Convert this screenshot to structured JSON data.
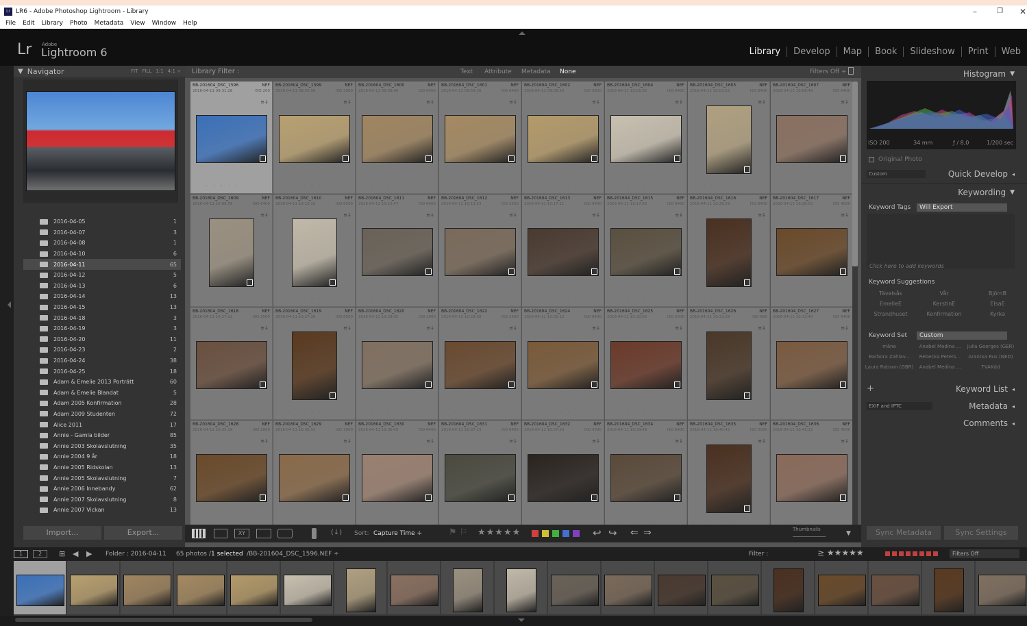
{
  "window": {
    "title": "LR6 - Adobe Photoshop Lightroom - Library",
    "app_icon": "Lr"
  },
  "menu": [
    "File",
    "Edit",
    "Library",
    "Photo",
    "Metadata",
    "View",
    "Window",
    "Help"
  ],
  "identity": {
    "lr": "Lr",
    "adobe": "Adobe",
    "product": "Lightroom 6"
  },
  "modules": [
    "Library",
    "Develop",
    "Map",
    "Book",
    "Slideshow",
    "Print",
    "Web"
  ],
  "navigator": {
    "title": "Navigator",
    "zoom": [
      "FIT",
      "FILL",
      "1:1",
      "4:1 ÷"
    ]
  },
  "folders": [
    {
      "name": "2016-04-05",
      "count": "1"
    },
    {
      "name": "2016-04-07",
      "count": "3"
    },
    {
      "name": "2016-04-08",
      "count": "1"
    },
    {
      "name": "2016-04-10",
      "count": "6"
    },
    {
      "name": "2016-04-11",
      "count": "65",
      "selected": true
    },
    {
      "name": "2016-04-12",
      "count": "5"
    },
    {
      "name": "2016-04-13",
      "count": "6"
    },
    {
      "name": "2016-04-14",
      "count": "13"
    },
    {
      "name": "2016-04-15",
      "count": "13"
    },
    {
      "name": "2016-04-18",
      "count": "3"
    },
    {
      "name": "2016-04-19",
      "count": "3"
    },
    {
      "name": "2016-04-20",
      "count": "11"
    },
    {
      "name": "2016-04-23",
      "count": "2"
    },
    {
      "name": "2016-04-24",
      "count": "38"
    },
    {
      "name": "2016-04-25",
      "count": "18"
    },
    {
      "name": "Adam & Emelie 2013 Porträtt",
      "count": "60"
    },
    {
      "name": "Adam & Emelie Blandat",
      "count": "5"
    },
    {
      "name": "Adam 2005 Konfirmation",
      "count": "28"
    },
    {
      "name": "Adam 2009 Studenten",
      "count": "72"
    },
    {
      "name": "Alice 2011",
      "count": "17"
    },
    {
      "name": "Annie - Gamla bilder",
      "count": "85"
    },
    {
      "name": "Annie 2003 Skolavslutning",
      "count": "35"
    },
    {
      "name": "Annie 2004 9 år",
      "count": "18"
    },
    {
      "name": "Annie 2005 Ridskolan",
      "count": "13"
    },
    {
      "name": "Annie 2005 Skolavslutning",
      "count": "7"
    },
    {
      "name": "Annie 2006 Innebandy",
      "count": "62"
    },
    {
      "name": "Annie 2007 Skolavslutning",
      "count": "8"
    },
    {
      "name": "Annie 2007 Vickan",
      "count": "13"
    }
  ],
  "left_buttons": {
    "import": "Import...",
    "export": "Export..."
  },
  "filter": {
    "label": "Library Filter :",
    "tabs": [
      "Text",
      "Attribute",
      "Metadata",
      "None"
    ],
    "status": "Filters Off ÷"
  },
  "grid": [
    {
      "name": "BB-201604_DSC_1596",
      "date": "2016-04-11 09:31:28",
      "iso": "ISO 200",
      "type": "NEF",
      "color": "#3a6fb8",
      "orient": "l",
      "selected": true
    },
    {
      "name": "BB-201604_DSC_1599",
      "date": "2016-04-11 09:55:06",
      "iso": "ISO 2000",
      "type": "NEF",
      "color": "#b8a070",
      "orient": "l"
    },
    {
      "name": "BB-201604_DSC_1600",
      "date": "2016-04-11 09:56:06",
      "iso": "ISO 6400",
      "type": "NEF",
      "color": "#a08560",
      "orient": "l"
    },
    {
      "name": "BB-201604_DSC_1601",
      "date": "2016-04-11 09:56:16",
      "iso": "ISO 6400",
      "type": "NEF",
      "color": "#a58a62",
      "orient": "l"
    },
    {
      "name": "BB-201604_DSC_1602",
      "date": "2016-04-11 09:58:20",
      "iso": "ISO 3600",
      "type": "NEF",
      "color": "#b49a6a",
      "orient": "l"
    },
    {
      "name": "BB-201604_DSC_1604",
      "date": "2016-04-11 10:01:02",
      "iso": "ISO 6400",
      "type": "NEF",
      "color": "#c8c0b0",
      "orient": "l"
    },
    {
      "name": "BB-201604_DSC_1605",
      "date": "2016-04-11 10:01:52",
      "iso": "ISO 6400",
      "type": "NEF",
      "color": "#b0a080",
      "orient": "p"
    },
    {
      "name": "BB-201604_DSC_1607",
      "date": "2016-04-11 10:08:49",
      "iso": "ISO 6400",
      "type": "NEF",
      "color": "#8a7060",
      "orient": "l"
    },
    {
      "name": "BB-201604_DSC_1609",
      "date": "2016-04-11 10:09:58",
      "iso": "ISO 6400",
      "type": "NEF",
      "color": "#9a9080",
      "orient": "p"
    },
    {
      "name": "BB-201604_DSC_1610",
      "date": "2016-04-11 10:10:15",
      "iso": "ISO 6500",
      "type": "NEF",
      "color": "#c0b8a8",
      "orient": "p"
    },
    {
      "name": "BB-201604_DSC_1611",
      "date": "2016-04-11 10:12:47",
      "iso": "ISO 6400",
      "type": "NEF",
      "color": "#6a6258",
      "orient": "l"
    },
    {
      "name": "BB-201604_DSC_1612",
      "date": "2016-04-11 10:13:53",
      "iso": "ISO 2500",
      "type": "NEF",
      "color": "#7a6a5a",
      "orient": "l"
    },
    {
      "name": "BB-201604_DSC_1613",
      "date": "2016-04-11 10:17:11",
      "iso": "ISO 6400",
      "type": "NEF",
      "color": "#4a3a30",
      "orient": "l"
    },
    {
      "name": "BB-201604_DSC_1615",
      "date": "2016-04-11 10:17:55",
      "iso": "ISO 6400",
      "type": "NEF",
      "color": "#5a5040",
      "orient": "l"
    },
    {
      "name": "BB-201604_DSC_1616",
      "date": "2016-04-11 10:26:29",
      "iso": "ISO 6400",
      "type": "NEF",
      "color": "#4a3020",
      "orient": "p"
    },
    {
      "name": "BB-201604_DSC_1617",
      "date": "2016-04-11 10:26:50",
      "iso": "ISO 4000",
      "type": "NEF",
      "color": "#6a4a2a",
      "orient": "l"
    },
    {
      "name": "BB-201604_DSC_1618",
      "date": "2016-04-11 10:27:21",
      "iso": "ISO 2500",
      "type": "NEF",
      "color": "#6a5040",
      "orient": "l"
    },
    {
      "name": "BB-201604_DSC_1619",
      "date": "2016-04-11 10:27:36",
      "iso": "ISO 6500",
      "type": "NEF",
      "color": "#5a3a20",
      "orient": "p"
    },
    {
      "name": "BB-201604_DSC_1620",
      "date": "2016-04-11 10:28:05",
      "iso": "ISO 2000",
      "type": "NEF",
      "color": "#807060",
      "orient": "l"
    },
    {
      "name": "BB-201604_DSC_1622",
      "date": "2016-04-11 10:28:38",
      "iso": "ISO 2500",
      "type": "NEF",
      "color": "#6a4a30",
      "orient": "l"
    },
    {
      "name": "BB-201604_DSC_1624",
      "date": "2016-04-11 10:30:12",
      "iso": "ISO 6400",
      "type": "NEF",
      "color": "#7a5a3a",
      "orient": "l"
    },
    {
      "name": "BB-201604_DSC_1625",
      "date": "2016-04-11 10:32:05",
      "iso": "ISO 2000",
      "type": "NEF",
      "color": "#6a3a2a",
      "orient": "l"
    },
    {
      "name": "BB-201604_DSC_1626",
      "date": "2016-04-11 10:32:29",
      "iso": "ISO 800",
      "type": "NEF",
      "color": "#4a3828",
      "orient": "p"
    },
    {
      "name": "BB-201604_DSC_1627",
      "date": "2016-04-11 10:33:40",
      "iso": "ISO 6400",
      "type": "NEF",
      "color": "#7a5a40",
      "orient": "l"
    },
    {
      "name": "BB-201604_DSC_1628",
      "date": "2016-04-11 10:35:16",
      "iso": "ISO 2000",
      "type": "NEF",
      "color": "#6a4a2a",
      "orient": "l"
    },
    {
      "name": "BB-201604_DSC_1629",
      "date": "2016-04-11 10:36:31",
      "iso": "ISO 1000",
      "type": "NEF",
      "color": "#8a6a4a",
      "orient": "l"
    },
    {
      "name": "BB-201604_DSC_1630",
      "date": "2016-04-11 10:36:45",
      "iso": "ISO 6400",
      "type": "NEF",
      "color": "#9a8070",
      "orient": "l"
    },
    {
      "name": "BB-201604_DSC_1631",
      "date": "2016-04-11 10:37:23",
      "iso": "ISO 6400",
      "type": "NEF",
      "color": "#4a4a40",
      "orient": "l"
    },
    {
      "name": "BB-201604_DSC_1632",
      "date": "2016-04-11 10:37:29",
      "iso": "ISO 4000",
      "type": "NEF",
      "color": "#2a2420",
      "orient": "l"
    },
    {
      "name": "BB-201604_DSC_1634",
      "date": "2016-04-11 10:39:49",
      "iso": "ISO 6400",
      "type": "NEF",
      "color": "#5a4a3a",
      "orient": "l"
    },
    {
      "name": "BB-201604_DSC_1635",
      "date": "2016-04-11 10:40:42",
      "iso": "ISO 2000",
      "type": "NEF",
      "color": "#4a3020",
      "orient": "p"
    },
    {
      "name": "BB-201604_DSC_1636",
      "date": "2016-04-11 10:45:22",
      "iso": "ISO 4000",
      "type": "NEF",
      "color": "#8a6a5a",
      "orient": "l"
    }
  ],
  "toolbar": {
    "sort_label": "Sort:",
    "sort_value": "Capture Time ÷",
    "thumbs_label": "Thumbnails"
  },
  "right": {
    "histogram": "Histogram",
    "iso": "ISO 200",
    "focal": "34 mm",
    "aperture": "ƒ / 8,0",
    "shutter": "1/200 sec",
    "original": "Original Photo",
    "qd_preset": "Custom",
    "quick_develop": "Quick Develop",
    "keywording": "Keywording",
    "kw_tags_label": "Keyword Tags",
    "kw_tags_value": "Will Export",
    "kw_placeholder": "Click here to add keywords",
    "kw_suggestions": "Keyword Suggestions",
    "suggestions": [
      "Tävelsås",
      "Vår",
      "BjörnB",
      "EmelieE",
      "KerstinE",
      "ElsaE",
      "Strandhuset",
      "Konfirmation",
      "Kyrka"
    ],
    "kw_set_label": "Keyword Set",
    "kw_set_value": "Custom",
    "set": [
      "måne",
      "Anabel Medina ...",
      "Julia Goerges (GER)",
      "Barbora Zahlav...",
      "Rebecka Peters...",
      "Arantxa Rus (NED)",
      "Laura Robson (GBR)",
      "Anabel Medina ...",
      "TVAKdd"
    ],
    "keyword_list": "Keyword List",
    "meta_preset": "EXIF and IPTC",
    "metadata": "Metadata",
    "comments": "Comments",
    "sync_meta": "Sync Metadata",
    "sync_settings": "Sync Settings"
  },
  "filmstrip": {
    "page1": "1",
    "page2": "2",
    "folder": "Folder : 2016-04-11",
    "count": "65 photos /",
    "selected": "1 selected",
    "path": "/BB-201604_DSC_1596.NEF ÷",
    "filter_label": "Filter :",
    "filter_status": "Filters Off"
  },
  "film_thumbs": [
    {
      "color": "#3a6fb8",
      "orient": "l"
    },
    {
      "color": "#b8a070",
      "orient": "l"
    },
    {
      "color": "#a08560",
      "orient": "l"
    },
    {
      "color": "#a58a62",
      "orient": "l"
    },
    {
      "color": "#b49a6a",
      "orient": "l"
    },
    {
      "color": "#c8c0b0",
      "orient": "l"
    },
    {
      "color": "#b0a080",
      "orient": "p"
    },
    {
      "color": "#8a7060",
      "orient": "l"
    },
    {
      "color": "#9a9080",
      "orient": "p"
    },
    {
      "color": "#c0b8a8",
      "orient": "p"
    },
    {
      "color": "#6a6258",
      "orient": "l"
    },
    {
      "color": "#7a6a5a",
      "orient": "l"
    },
    {
      "color": "#4a3a30",
      "orient": "l"
    },
    {
      "color": "#5a5040",
      "orient": "l"
    },
    {
      "color": "#4a3020",
      "orient": "p"
    },
    {
      "color": "#6a4a2a",
      "orient": "l"
    },
    {
      "color": "#6a5040",
      "orient": "l"
    },
    {
      "color": "#5a3a20",
      "orient": "p"
    },
    {
      "color": "#807060",
      "orient": "l"
    }
  ],
  "colors": {
    "label_red": "#d04040",
    "label_yellow": "#d0c030",
    "label_green": "#40b040",
    "label_blue": "#4070d0",
    "label_purple": "#8040c0"
  }
}
